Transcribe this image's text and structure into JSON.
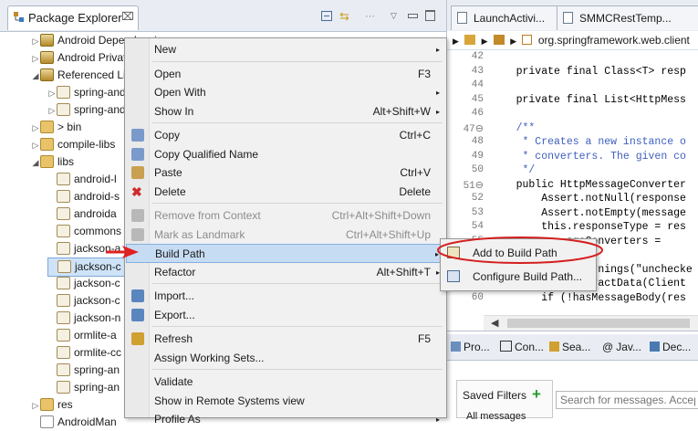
{
  "package_explorer": {
    "tab_title": "Package Explorer",
    "tab_suffix": "⌧",
    "tree": [
      {
        "label": "Android Dependencies",
        "icon": "library-icon",
        "twisty": "▷",
        "indent": 0
      },
      {
        "label": "Android Private Libraries",
        "icon": "library-icon",
        "twisty": "▷",
        "indent": 0
      },
      {
        "label": "Referenced Libraries",
        "icon": "library-icon",
        "twisty": "◢",
        "indent": 0
      },
      {
        "label": "spring-android-core",
        "icon": "jar-icon",
        "twisty": "▷",
        "indent": 1
      },
      {
        "label": "spring-android-rest-template",
        "icon": "jar-icon",
        "twisty": "▷",
        "indent": 1
      },
      {
        "label": "> bin",
        "icon": "folder-icon",
        "twisty": "▷",
        "indent": 0
      },
      {
        "label": "compile-libs",
        "icon": "folder-icon",
        "twisty": "▷",
        "indent": 0
      },
      {
        "label": "libs",
        "icon": "folder-icon",
        "twisty": "◢",
        "indent": 0
      },
      {
        "label": "android-l",
        "icon": "jar-icon",
        "twisty": "",
        "indent": 1
      },
      {
        "label": "android-s",
        "icon": "jar-icon",
        "twisty": "",
        "indent": 1
      },
      {
        "label": "androida",
        "icon": "jar-icon",
        "twisty": "",
        "indent": 1
      },
      {
        "label": "commons",
        "icon": "jar-icon",
        "twisty": "",
        "indent": 1
      },
      {
        "label": "jackson-a",
        "icon": "jar-icon",
        "twisty": "",
        "indent": 1
      },
      {
        "label": "jackson-c",
        "icon": "jar-icon",
        "twisty": "",
        "indent": 1,
        "selected": true
      },
      {
        "label": "jackson-c",
        "icon": "jar-icon",
        "twisty": "",
        "indent": 1
      },
      {
        "label": "jackson-c",
        "icon": "jar-icon",
        "twisty": "",
        "indent": 1
      },
      {
        "label": "jackson-n",
        "icon": "jar-icon",
        "twisty": "",
        "indent": 1
      },
      {
        "label": "ormlite-a",
        "icon": "jar-icon",
        "twisty": "",
        "indent": 1
      },
      {
        "label": "ormlite-cc",
        "icon": "jar-icon",
        "twisty": "",
        "indent": 1
      },
      {
        "label": "spring-an",
        "icon": "jar-icon",
        "twisty": "",
        "indent": 1
      },
      {
        "label": "spring-an",
        "icon": "jar-icon",
        "twisty": "",
        "indent": 1
      },
      {
        "label": "res",
        "icon": "folder-icon",
        "twisty": "▷",
        "indent": 0
      },
      {
        "label": "AndroidMan",
        "icon": "file-icon",
        "twisty": "",
        "indent": 0
      }
    ]
  },
  "context_menu": {
    "items": [
      {
        "label": "New",
        "shortcut": "",
        "arrow": "▸",
        "icon": "",
        "disabled": false
      },
      {
        "sep": true
      },
      {
        "label": "Open",
        "shortcut": "F3",
        "arrow": "",
        "icon": "",
        "disabled": false
      },
      {
        "label": "Open With",
        "shortcut": "",
        "arrow": "▸",
        "icon": "",
        "disabled": false
      },
      {
        "label": "Show In",
        "shortcut": "Alt+Shift+W",
        "arrow": "▸",
        "icon": "",
        "disabled": false
      },
      {
        "sep": true
      },
      {
        "label": "Copy",
        "shortcut": "Ctrl+C",
        "arrow": "",
        "icon": "copy-icon",
        "disabled": false
      },
      {
        "label": "Copy Qualified Name",
        "shortcut": "",
        "arrow": "",
        "icon": "copy-icon",
        "disabled": false
      },
      {
        "label": "Paste",
        "shortcut": "Ctrl+V",
        "arrow": "",
        "icon": "paste-icon",
        "disabled": false
      },
      {
        "label": "Delete",
        "shortcut": "Delete",
        "arrow": "",
        "icon": "delete-icon",
        "disabled": false
      },
      {
        "sep": true
      },
      {
        "label": "Remove from Context",
        "shortcut": "Ctrl+Alt+Shift+Down",
        "arrow": "",
        "icon": "remove-context-icon",
        "disabled": true
      },
      {
        "label": "Mark as Landmark",
        "shortcut": "Ctrl+Alt+Shift+Up",
        "arrow": "",
        "icon": "landmark-icon",
        "disabled": true
      },
      {
        "label": "Build Path",
        "shortcut": "",
        "arrow": "▸",
        "icon": "",
        "disabled": false,
        "highlighted": true
      },
      {
        "label": "Refactor",
        "shortcut": "Alt+Shift+T",
        "arrow": "▸",
        "icon": "",
        "disabled": false
      },
      {
        "sep": true
      },
      {
        "label": "Import...",
        "shortcut": "",
        "arrow": "",
        "icon": "import-icon",
        "disabled": false
      },
      {
        "label": "Export...",
        "shortcut": "",
        "arrow": "",
        "icon": "export-icon",
        "disabled": false
      },
      {
        "sep": true
      },
      {
        "label": "Refresh",
        "shortcut": "F5",
        "arrow": "",
        "icon": "refresh-icon",
        "disabled": false
      },
      {
        "label": "Assign Working Sets...",
        "shortcut": "",
        "arrow": "",
        "icon": "",
        "disabled": false
      },
      {
        "sep": true
      },
      {
        "label": "Validate",
        "shortcut": "",
        "arrow": "",
        "icon": "",
        "disabled": false
      },
      {
        "label": "Show in Remote Systems view",
        "shortcut": "",
        "arrow": "",
        "icon": "",
        "disabled": false
      },
      {
        "label": "Profile As",
        "shortcut": "",
        "arrow": "▸",
        "icon": "",
        "disabled": false
      }
    ]
  },
  "submenu": {
    "items": [
      {
        "label": "Add to Build Path",
        "icon": "add-to-build-path-icon"
      },
      {
        "label": "Configure Build Path...",
        "icon": "configure-build-path-icon"
      }
    ]
  },
  "editor": {
    "tabs": [
      {
        "label": "LaunchActivi...",
        "icon": "java-file-icon"
      },
      {
        "label": "SMMCRestTemp...",
        "icon": "java-file-icon"
      }
    ],
    "breadcrumb": "org.springframework.web.client",
    "lines": [
      {
        "n": "42",
        "text": ""
      },
      {
        "n": "43",
        "text": "    private final Class<T> resp"
      },
      {
        "n": "44",
        "text": ""
      },
      {
        "n": "45",
        "text": "    private final List<HttpMess"
      },
      {
        "n": "46",
        "text": ""
      },
      {
        "n": "47⊖",
        "text": "    /**"
      },
      {
        "n": "48",
        "text": "     * Creates a new instance o"
      },
      {
        "n": "49",
        "text": "     * converters. The given co"
      },
      {
        "n": "50",
        "text": "     */"
      },
      {
        "n": "51⊖",
        "text": "    public HttpMessageConverter"
      },
      {
        "n": "52",
        "text": "        Assert.notNull(response"
      },
      {
        "n": "53",
        "text": "        Assert.notEmpty(message"
      },
      {
        "n": "54",
        "text": "        this.responseType = res"
      },
      {
        "n": "55",
        "text": "            ageConverters ="
      },
      {
        "n": "56",
        "text": ""
      },
      {
        "n": "57⊖",
        "text": "    @Suppress Warnings(\"unchecke"
      },
      {
        "n": "59",
        "text": "    public T extractData(Client"
      },
      {
        "n": "60",
        "text": "        if (!hasMessageBody(res"
      }
    ]
  },
  "bottom_panel": {
    "tabs": [
      {
        "label": "Pro...",
        "icon": "problems-icon"
      },
      {
        "label": "Con...",
        "icon": "console-icon"
      },
      {
        "label": "Sea...",
        "icon": "search-icon"
      },
      {
        "label": "Jav...",
        "icon": "javadoc-icon"
      },
      {
        "label": "Dec...",
        "icon": "declaration-icon"
      }
    ],
    "saved_filters_label": "Saved Filters",
    "search_placeholder": "Search for messages. Accep",
    "all_messages": "All messages"
  },
  "colors": {
    "highlight": "#c6dcf3",
    "annotation_circle": "#d41f1f",
    "arrow": "#e02020"
  }
}
